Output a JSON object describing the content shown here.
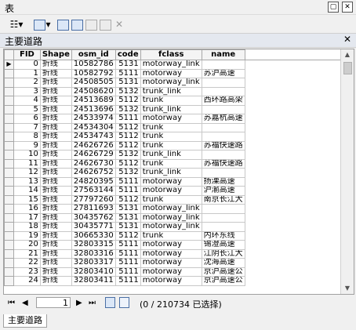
{
  "window": {
    "title": "表",
    "pin": "▢",
    "close": "✕"
  },
  "toolbar": {
    "table_options": "☷▾",
    "related_tables": "▾"
  },
  "layer_tab": {
    "label": "主要道路",
    "close": "✕"
  },
  "table": {
    "columns": [
      "FID",
      "Shape",
      "osm_id",
      "code",
      "fclass",
      "name"
    ],
    "rows": [
      [
        "0",
        "折线",
        "10582786",
        "5131",
        "motorway_link",
        ""
      ],
      [
        "1",
        "折线",
        "10582792",
        "5111",
        "motorway",
        "苏沪高速"
      ],
      [
        "2",
        "折线",
        "24508505",
        "5131",
        "motorway_link",
        ""
      ],
      [
        "3",
        "折线",
        "24508620",
        "5132",
        "trunk_link",
        ""
      ],
      [
        "4",
        "折线",
        "24513689",
        "5112",
        "trunk",
        "西环路高架"
      ],
      [
        "5",
        "折线",
        "24513696",
        "5132",
        "trunk_link",
        ""
      ],
      [
        "6",
        "折线",
        "24533974",
        "5111",
        "motorway",
        "苏嘉杭高速"
      ],
      [
        "7",
        "折线",
        "24534304",
        "5112",
        "trunk",
        ""
      ],
      [
        "8",
        "折线",
        "24534743",
        "5112",
        "trunk",
        ""
      ],
      [
        "9",
        "折线",
        "24626726",
        "5112",
        "trunk",
        "苏福快速路"
      ],
      [
        "10",
        "折线",
        "24626729",
        "5132",
        "trunk_link",
        ""
      ],
      [
        "11",
        "折线",
        "24626730",
        "5112",
        "trunk",
        "苏福快速路"
      ],
      [
        "12",
        "折线",
        "24626752",
        "5132",
        "trunk_link",
        ""
      ],
      [
        "13",
        "折线",
        "24820395",
        "5111",
        "motorway",
        "扬溧高速"
      ],
      [
        "14",
        "折线",
        "27563144",
        "5111",
        "motorway",
        "沪渝高速"
      ],
      [
        "15",
        "折线",
        "27797260",
        "5112",
        "trunk",
        "南京长江大"
      ],
      [
        "16",
        "折线",
        "27811693",
        "5131",
        "motorway_link",
        ""
      ],
      [
        "17",
        "折线",
        "30435762",
        "5131",
        "motorway_link",
        ""
      ],
      [
        "18",
        "折线",
        "30435771",
        "5131",
        "motorway_link",
        ""
      ],
      [
        "19",
        "折线",
        "30665330",
        "5112",
        "trunk",
        "内环东线"
      ],
      [
        "20",
        "折线",
        "32803315",
        "5111",
        "motorway",
        "锡澄高速"
      ],
      [
        "21",
        "折线",
        "32803316",
        "5111",
        "motorway",
        "江阴长江大"
      ],
      [
        "22",
        "折线",
        "32803317",
        "5111",
        "motorway",
        "沈海高速"
      ],
      [
        "23",
        "折线",
        "32803410",
        "5111",
        "motorway",
        "京沪高速公"
      ],
      [
        "24",
        "折线",
        "32803411",
        "5111",
        "motorway",
        "京沪高速公"
      ]
    ]
  },
  "nav": {
    "first": "⏮",
    "prev": "◀",
    "page": "1",
    "next": "▶",
    "last": "⏭",
    "status": "(0 / 210734 已选择)"
  },
  "bottom_tab": {
    "label": "主要道路"
  }
}
